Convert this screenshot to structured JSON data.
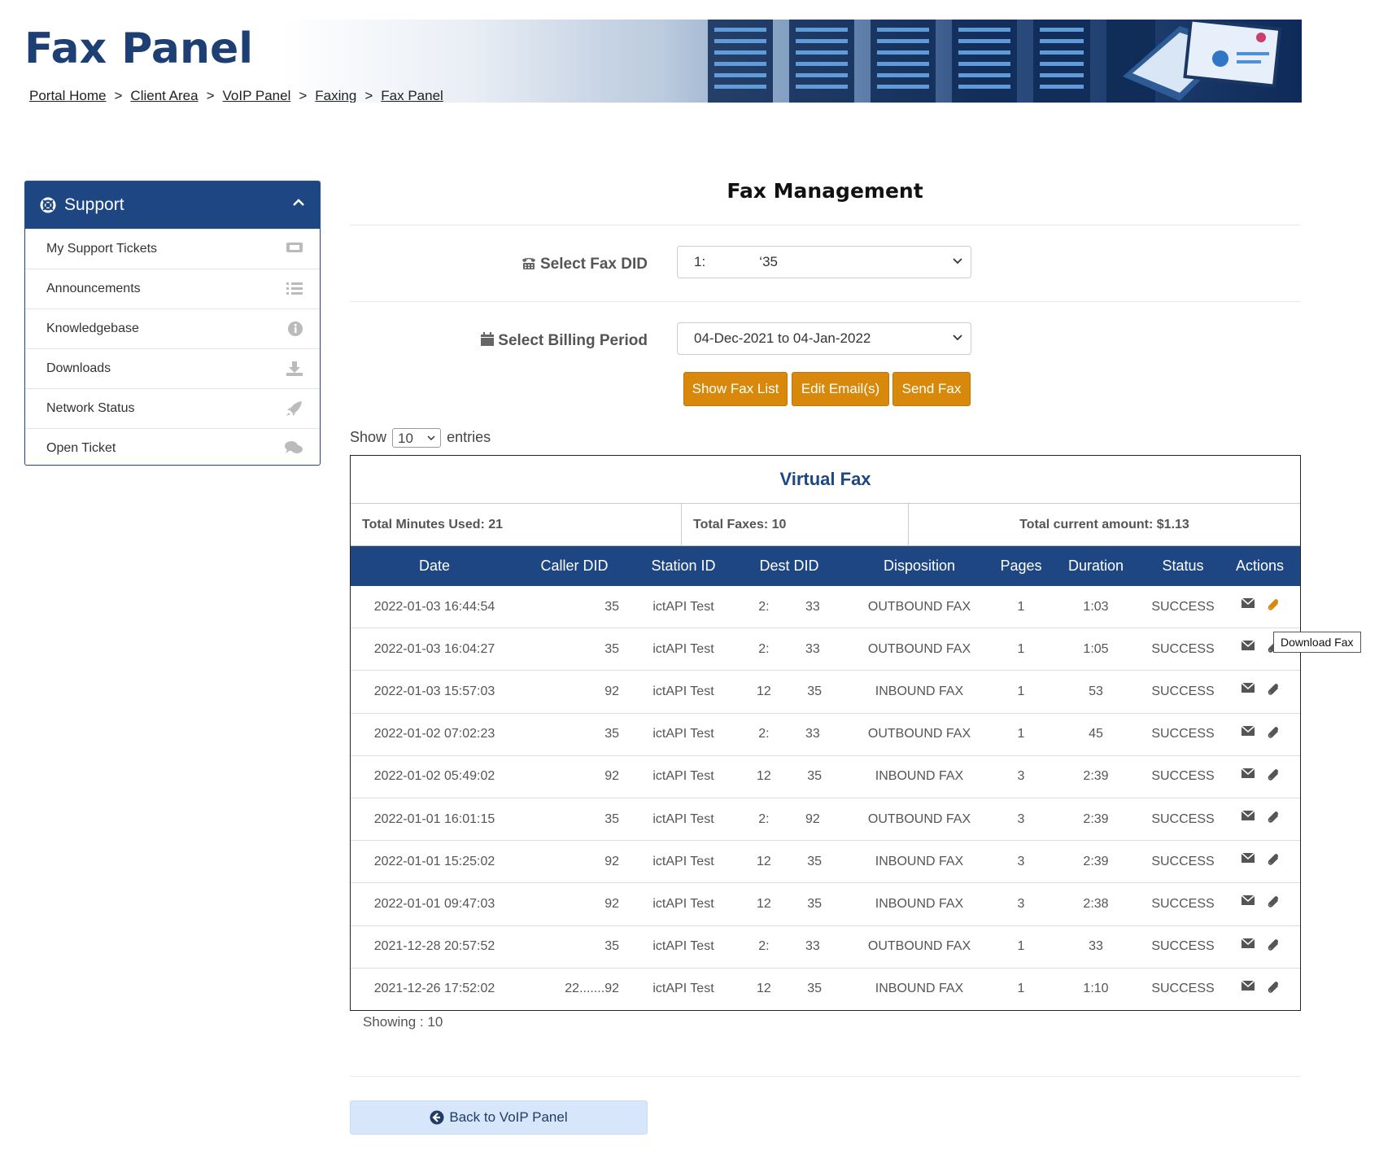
{
  "header": {
    "title": "Fax Panel",
    "breadcrumb": [
      "Portal Home",
      "Client Area",
      "VoIP Panel",
      "Faxing",
      "Fax Panel"
    ],
    "breadcrumb_separator": ">"
  },
  "sidebar": {
    "title": "Support",
    "items": [
      {
        "label": "My Support Tickets",
        "icon": "ticket-icon"
      },
      {
        "label": "Announcements",
        "icon": "list-icon"
      },
      {
        "label": "Knowledgebase",
        "icon": "info-icon"
      },
      {
        "label": "Downloads",
        "icon": "download-icon"
      },
      {
        "label": "Network Status",
        "icon": "rocket-icon"
      },
      {
        "label": "Open Ticket",
        "icon": "comments-icon"
      }
    ]
  },
  "main": {
    "title": "Fax Management",
    "fax_did_label": "Select Fax DID",
    "fax_did_value": "1:              ‘35",
    "billing_label": "Select Billing Period",
    "billing_value": "04-Dec-2021 to 04-Jan-2022",
    "buttons": {
      "show_fax_list": "Show Fax List",
      "edit_emails": "Edit Email(s)",
      "send_fax": "Send Fax"
    },
    "show_label": "Show",
    "entries_value": "10",
    "entries_label": "entries"
  },
  "table": {
    "title": "Virtual Fax",
    "total_minutes": "Total Minutes Used: 21",
    "total_faxes": "Total Faxes: 10",
    "total_amount": "Total current amount: $1.13",
    "columns": [
      "Date",
      "Caller DID",
      "Station ID",
      "Dest DID",
      "Disposition",
      "Pages",
      "Duration",
      "Status",
      "Actions"
    ],
    "rows": [
      {
        "date": "2022-01-03 16:44:54",
        "caller": "35",
        "station": "ictAPI Test",
        "dest": "2:          33",
        "disp": "OUTBOUND FAX",
        "pages": "1",
        "dur": "1:03",
        "status": "SUCCESS"
      },
      {
        "date": "2022-01-03 16:04:27",
        "caller": "35",
        "station": "ictAPI Test",
        "dest": "2:          33",
        "disp": "OUTBOUND FAX",
        "pages": "1",
        "dur": "1:05",
        "status": "SUCCESS"
      },
      {
        "date": "2022-01-03 15:57:03",
        "caller": "92",
        "station": "ictAPI Test",
        "dest": "12          35",
        "disp": "INBOUND FAX",
        "pages": "1",
        "dur": "53",
        "status": "SUCCESS"
      },
      {
        "date": "2022-01-02 07:02:23",
        "caller": "35",
        "station": "ictAPI Test",
        "dest": "2:          33",
        "disp": "OUTBOUND FAX",
        "pages": "1",
        "dur": "45",
        "status": "SUCCESS"
      },
      {
        "date": "2022-01-02 05:49:02",
        "caller": "92",
        "station": "ictAPI Test",
        "dest": "12          35",
        "disp": "INBOUND FAX",
        "pages": "3",
        "dur": "2:39",
        "status": "SUCCESS"
      },
      {
        "date": "2022-01-01 16:01:15",
        "caller": "35",
        "station": "ictAPI Test",
        "dest": "2:          92",
        "disp": "OUTBOUND FAX",
        "pages": "3",
        "dur": "2:39",
        "status": "SUCCESS"
      },
      {
        "date": "2022-01-01 15:25:02",
        "caller": "92",
        "station": "ictAPI Test",
        "dest": "12          35",
        "disp": "INBOUND FAX",
        "pages": "3",
        "dur": "2:39",
        "status": "SUCCESS"
      },
      {
        "date": "2022-01-01 09:47:03",
        "caller": "92",
        "station": "ictAPI Test",
        "dest": "12          35",
        "disp": "INBOUND FAX",
        "pages": "3",
        "dur": "2:38",
        "status": "SUCCESS"
      },
      {
        "date": "2021-12-28 20:57:52",
        "caller": "35",
        "station": "ictAPI Test",
        "dest": "2:          33",
        "disp": "OUTBOUND FAX",
        "pages": "1",
        "dur": "33",
        "status": "SUCCESS"
      },
      {
        "date": "2021-12-26 17:52:02",
        "caller": "22.......92",
        "station": "ictAPI Test",
        "dest": "12          35",
        "disp": "INBOUND FAX",
        "pages": "1",
        "dur": "1:10",
        "status": "SUCCESS"
      }
    ],
    "tooltip": "Download Fax"
  },
  "footer": {
    "showing": "Showing : 10",
    "back_button": "Back to VoIP Panel"
  },
  "colors": {
    "primary": "#1d4683",
    "accent_orange": "#d8890c",
    "back_button_bg": "#d7e6fb"
  }
}
